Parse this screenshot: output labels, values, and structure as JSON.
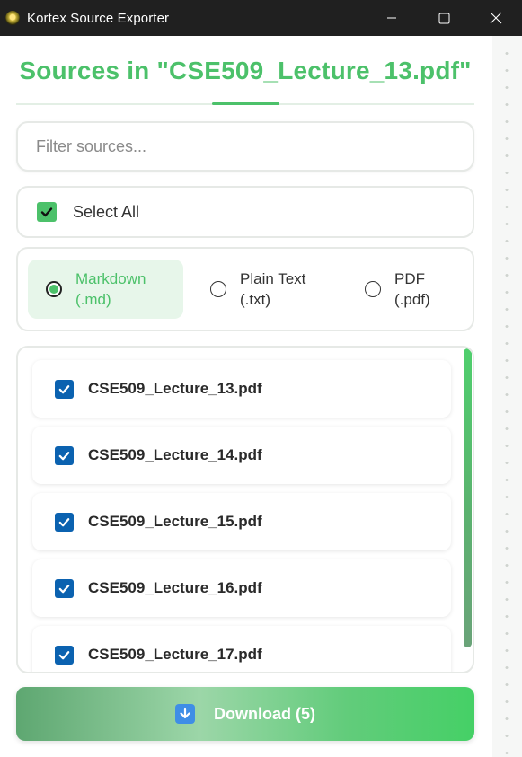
{
  "window": {
    "title": "Kortex Source Exporter"
  },
  "header": {
    "title": "Sources in \"CSE509_Lecture_13.pdf\""
  },
  "filter": {
    "placeholder": "Filter sources...",
    "value": ""
  },
  "select_all": {
    "label": "Select All",
    "checked": true
  },
  "formats": [
    {
      "line1": "Markdown",
      "line2": "(.md)",
      "selected": true
    },
    {
      "line1": "Plain Text",
      "line2": "(.txt)",
      "selected": false
    },
    {
      "line1": "PDF",
      "line2": "(.pdf)",
      "selected": false
    }
  ],
  "files": [
    {
      "name": "CSE509_Lecture_13.pdf",
      "checked": true
    },
    {
      "name": "CSE509_Lecture_14.pdf",
      "checked": true
    },
    {
      "name": "CSE509_Lecture_15.pdf",
      "checked": true
    },
    {
      "name": "CSE509_Lecture_16.pdf",
      "checked": true
    },
    {
      "name": "CSE509_Lecture_17.pdf",
      "checked": true
    }
  ],
  "download": {
    "label": "Download (5)"
  },
  "colors": {
    "accent": "#4cc16a",
    "checkbox_blue": "#0b62b0",
    "titlebar": "#202020"
  },
  "icons": {
    "app": "kortex-app-icon",
    "download": "download-arrow-icon"
  }
}
